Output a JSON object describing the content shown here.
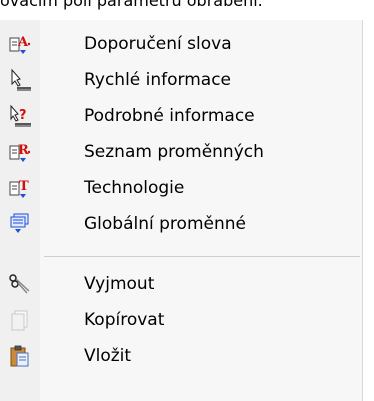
{
  "header_text": "ovacím poli parametru obrábění.",
  "menu": {
    "items": [
      {
        "label": "Doporučení slova",
        "icon": "word-suggestion-icon"
      },
      {
        "label": "Rychlé informace",
        "icon": "quick-info-icon"
      },
      {
        "label": "Podrobné informace",
        "icon": "detailed-info-icon"
      },
      {
        "label": "Seznam proměnných",
        "icon": "variable-list-icon"
      },
      {
        "label": "Technologie",
        "icon": "technology-icon"
      },
      {
        "label": "Globální proměnné",
        "icon": "global-variables-icon"
      },
      {
        "label": "Vyjmout",
        "icon": "scissors-icon"
      },
      {
        "label": "Kopírovat",
        "icon": "copy-icon"
      },
      {
        "label": "Vložit",
        "icon": "paste-icon"
      }
    ]
  },
  "colors": {
    "red": "#d01010",
    "blue": "#1c4fd6",
    "menu_bg": "#f7f7f7"
  }
}
